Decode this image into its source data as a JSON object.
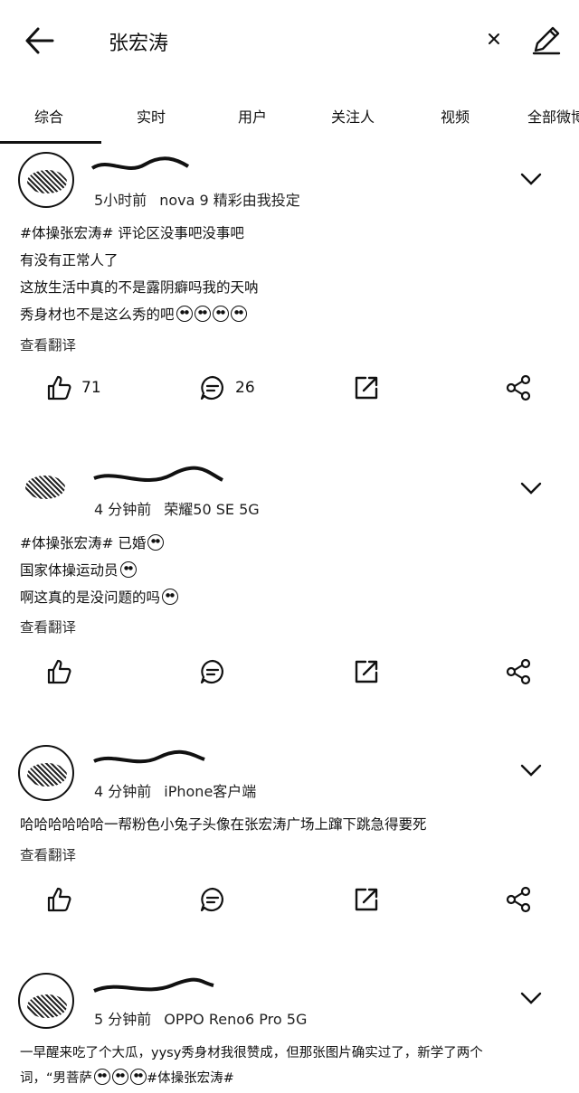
{
  "search": {
    "query": "张宏涛"
  },
  "tabs": [
    "综合",
    "实时",
    "用户",
    "关注人",
    "视频",
    "全部微博"
  ],
  "posts": [
    {
      "time": "5小时前",
      "source": "nova 9 精彩由我投定",
      "lines": [
        "#体操张宏涛# 评论区没事吧没事吧",
        "有没有正常人了",
        "这放生活中真的不是露阴癖吗我的天呐",
        "秀身材也不是这么秀的吧"
      ],
      "translate": "查看翻译",
      "likes": "71",
      "comments": "26"
    },
    {
      "time": "4 分钟前",
      "source": "荣耀50 SE 5G",
      "lines": [
        "#体操张宏涛# 已婚",
        "国家体操运动员",
        "啊这真的是没问题的吗"
      ],
      "translate": "查看翻译"
    },
    {
      "time": "4 分钟前",
      "source": "iPhone客户端",
      "lines": [
        "哈哈哈哈哈哈一帮粉色小兔子头像在张宏涛广场上蹿下跳急得要死"
      ],
      "translate": "查看翻译"
    },
    {
      "time": "5 分钟前",
      "source": "OPPO Reno6 Pro 5G",
      "lines": [
        "一早醒来吃了个大瓜，yysy秀身材我很赞成，但那张图片确实过了，新学了两个",
        "词，“男菩萨"
      ],
      "tail": "#体操张宏涛#"
    }
  ]
}
